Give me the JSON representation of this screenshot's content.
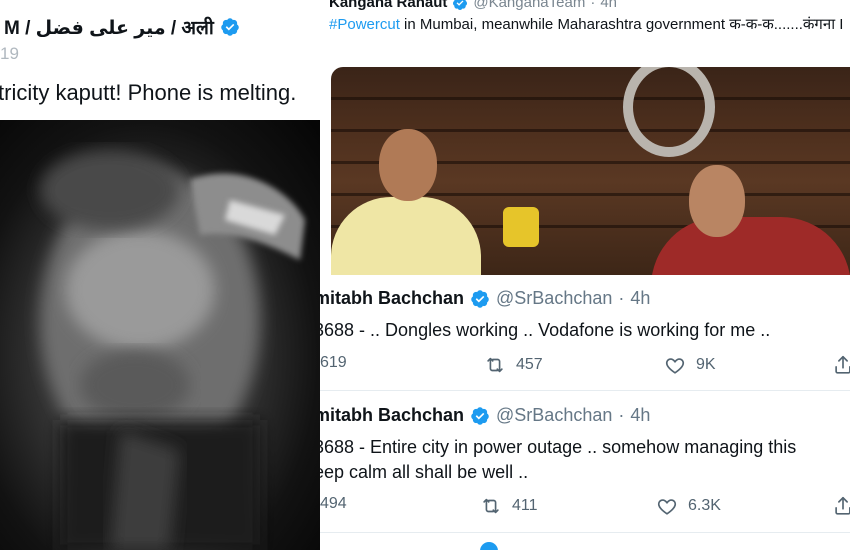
{
  "left_tweet": {
    "display_name": "M / میر علی فضل / अली",
    "timestamp": "19",
    "text": "tricity kaputt! Phone is melting."
  },
  "top_tweet": {
    "display_name": "Kangana Ranaut",
    "handle": "@KanganaTeam",
    "separator": "·",
    "time": "4h",
    "hashtag": "#Powercut",
    "text": " in Mumbai, meanwhile Maharashtra government क-क-क.......कंगना I"
  },
  "tweets": [
    {
      "display_name": "mitabh Bachchan",
      "handle": "@SrBachchan",
      "separator": "·",
      "time": "4h",
      "lines": [
        "3688 - .. Dongles working .. Vodafone is working for me .."
      ],
      "replies": "619",
      "retweets": "457",
      "likes": "9K"
    },
    {
      "display_name": "mitabh Bachchan",
      "handle": "@SrBachchan",
      "separator": "·",
      "time": "4h",
      "lines": [
        "3688 - Entire city in power outage .. somehow managing this",
        "eep calm all shall be well .."
      ],
      "replies": "494",
      "retweets": "411",
      "likes": "6.3K"
    }
  ],
  "icons": {
    "verified": "verified-badge-icon",
    "reply": "reply-icon",
    "retweet": "retweet-icon",
    "like": "heart-icon",
    "share": "share-icon"
  },
  "colors": {
    "accent": "#1d9bf0",
    "text": "#0f1419",
    "muted": "#536471"
  }
}
